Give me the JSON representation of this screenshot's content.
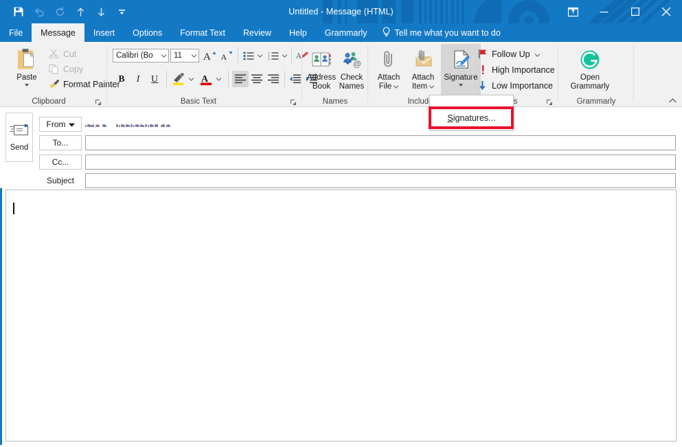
{
  "window": {
    "title": "Untitled  -  Message (HTML)",
    "accent_color": "#1479c5",
    "ribbon_bg": "#f1f1f1"
  },
  "quick_access": {
    "items": [
      {
        "name": "save-icon",
        "label": "Save",
        "disabled": false
      },
      {
        "name": "undo-icon",
        "label": "Undo",
        "disabled": true
      },
      {
        "name": "redo-icon",
        "label": "Redo",
        "disabled": true
      },
      {
        "name": "previous-item-icon",
        "label": "Previous Item",
        "disabled": false
      },
      {
        "name": "next-item-icon",
        "label": "Next Item",
        "disabled": false
      },
      {
        "name": "customize-qat-icon",
        "label": "Customize Quick Access Toolbar",
        "disabled": false
      }
    ]
  },
  "window_controls": {
    "ribbon_display": "Ribbon Display Options",
    "minimize": "Minimize",
    "maximize": "Maximize",
    "close": "Close"
  },
  "tabs": [
    {
      "label": "File",
      "active": false
    },
    {
      "label": "Message",
      "active": true
    },
    {
      "label": "Insert",
      "active": false
    },
    {
      "label": "Options",
      "active": false
    },
    {
      "label": "Format Text",
      "active": false
    },
    {
      "label": "Review",
      "active": false
    },
    {
      "label": "Help",
      "active": false
    },
    {
      "label": "Grammarly",
      "active": false
    }
  ],
  "tell_me": {
    "label": "Tell me what you want to do",
    "icon": "lightbulb-icon"
  },
  "ribbon": {
    "clipboard": {
      "group_label": "Clipboard",
      "paste": "Paste",
      "cut": "Cut",
      "copy": "Copy",
      "format_painter": "Format Painter"
    },
    "basic_text": {
      "group_label": "Basic Text",
      "font_name": "Calibri (Bo",
      "font_size": "11",
      "grow_font": "Increase Font Size",
      "shrink_font": "Decrease Font Size",
      "bullets": "Bullets",
      "numbering": "Numbering",
      "clear_formatting": "Clear All Formatting",
      "bold": "B",
      "italic": "I",
      "underline": "U",
      "highlight": "Text Highlight Color",
      "font_color": "Font Color",
      "align_left": "Align Left",
      "align_center": "Center",
      "align_right": "Align Right",
      "decrease_indent": "Decrease Indent",
      "increase_indent": "Increase Indent"
    },
    "names": {
      "group_label": "Names",
      "address_book_line1": "Address",
      "address_book_line2": "Book",
      "check_names_line1": "Check",
      "check_names_line2": "Names"
    },
    "include": {
      "group_label": "Include",
      "attach_file_line1": "Attach",
      "attach_file_line2": "File",
      "attach_item_line1": "Attach",
      "attach_item_line2": "Item",
      "signature": "Signature"
    },
    "tags": {
      "group_label": "Tags",
      "follow_up": "Follow Up",
      "high_importance": "High Importance",
      "low_importance": "Low Importance"
    },
    "grammarly": {
      "group_label": "Grammarly",
      "open_line1": "Open",
      "open_line2": "Grammarly",
      "brand_color": "#15c39a"
    },
    "collapse_ribbon": "Collapse the Ribbon"
  },
  "signature_menu": {
    "items": [
      {
        "label_prefix": "S",
        "label_rest": "ignatures..."
      }
    ],
    "highlight_color": "#e8112d"
  },
  "compose": {
    "send": "Send",
    "from_label": "From",
    "from_value": "",
    "to_label": "To...",
    "to_value": "",
    "cc_label": "Cc...",
    "cc_value": "",
    "subject_label": "Subject",
    "subject_value": "",
    "body_value": ""
  }
}
